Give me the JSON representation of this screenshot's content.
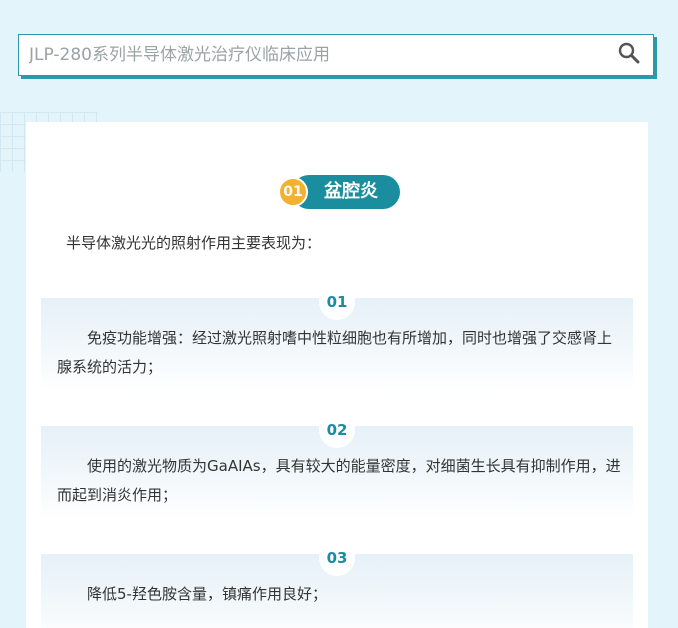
{
  "search": {
    "value": "",
    "placeholder": "JLP-280系列半导体激光治疗仪临床应用",
    "button_icon": "search-icon"
  },
  "section": {
    "number": "01",
    "title": "盆腔炎",
    "intro": "半导体激光光的照射作用主要表现为："
  },
  "items": [
    {
      "number": "01",
      "text": "免疫功能增强：经过激光照射嗜中性粒细胞也有所增加，同时也增强了交感肾上腺系统的活力；"
    },
    {
      "number": "02",
      "text": "使用的激光物质为GaAIAs，具有较大的能量密度，对细菌生长具有抑制作用，进而起到消炎作用；"
    },
    {
      "number": "03",
      "text": "降低5-羟色胺含量，镇痛作用良好；"
    }
  ],
  "colors": {
    "accent": "#1a8e9e",
    "badge": "#f4b12f",
    "background": "#e4f4fb"
  }
}
